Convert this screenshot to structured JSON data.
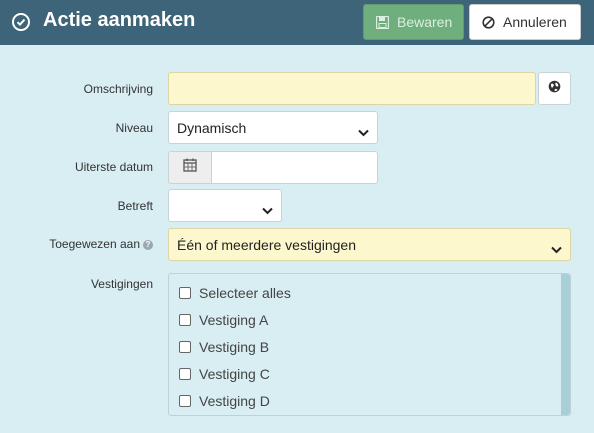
{
  "header": {
    "title": "Actie aanmaken",
    "save_label": "Bewaren",
    "cancel_label": "Annuleren"
  },
  "form": {
    "omschrijving": {
      "label": "Omschrijving",
      "value": ""
    },
    "niveau": {
      "label": "Niveau",
      "value": "Dynamisch"
    },
    "uiterste_datum": {
      "label": "Uiterste datum",
      "value": ""
    },
    "betreft": {
      "label": "Betreft",
      "value": ""
    },
    "toegewezen_aan": {
      "label": "Toegewezen aan",
      "value": "Één of meerdere vestigingen",
      "help": "?"
    },
    "vestigingen": {
      "label": "Vestigingen",
      "options": [
        "Selecteer alles",
        "Vestiging A",
        "Vestiging B",
        "Vestiging C",
        "Vestiging D"
      ]
    }
  },
  "colors": {
    "header": "#3d6478",
    "background": "#d8eef3",
    "save_button": "#6fae7d",
    "highlight_field": "#fdf7cd"
  }
}
